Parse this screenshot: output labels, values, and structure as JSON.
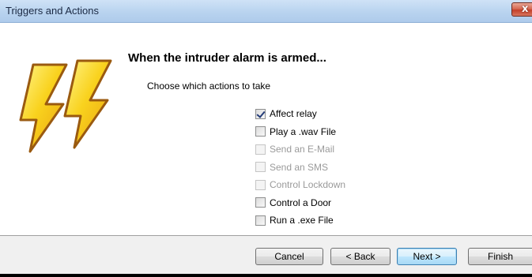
{
  "window": {
    "title": "Triggers and Actions",
    "close_symbol": "x"
  },
  "content": {
    "heading": "When the intruder alarm is armed...",
    "subheading": "Choose which actions to take",
    "logo_icon": "lightning-bolts-icon"
  },
  "options": [
    {
      "label": "Affect relay",
      "checked": true,
      "enabled": true
    },
    {
      "label": "Play a .wav File",
      "checked": false,
      "enabled": true
    },
    {
      "label": "Send an E-Mail",
      "checked": false,
      "enabled": false
    },
    {
      "label": "Send an SMS",
      "checked": false,
      "enabled": false
    },
    {
      "label": "Control Lockdown",
      "checked": false,
      "enabled": false
    },
    {
      "label": "Control a Door",
      "checked": false,
      "enabled": true
    },
    {
      "label": "Run a .exe File",
      "checked": false,
      "enabled": true
    }
  ],
  "footer": {
    "cancel_label": "Cancel",
    "back_label": "< Back",
    "next_label": "Next >",
    "finish_label": "Finish"
  },
  "colors": {
    "titlebar": "#b9d3ef",
    "close_button": "#c4402a",
    "bolt_fill": "#f7c81c",
    "footer_bg": "#f0f0f0"
  }
}
